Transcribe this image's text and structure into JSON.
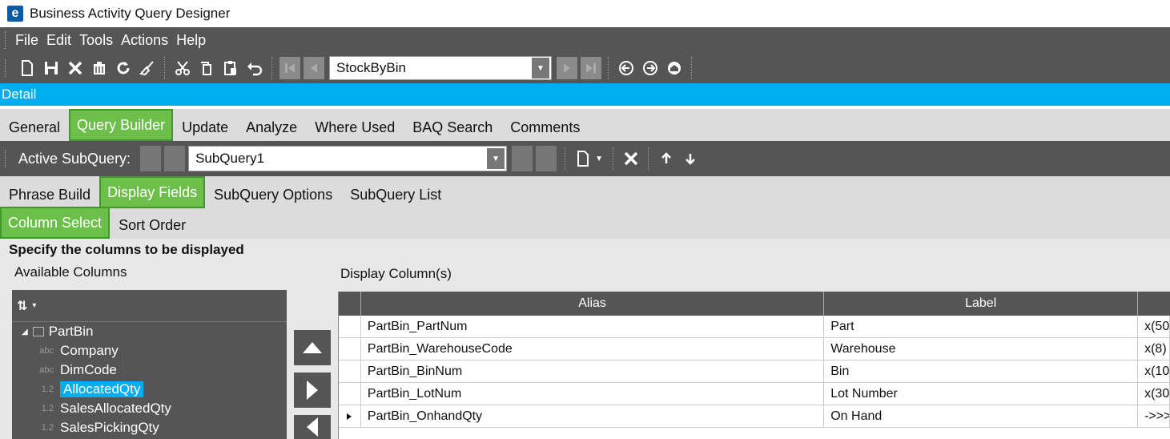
{
  "window": {
    "title": "Business Activity Query Designer",
    "logo_letter": "e"
  },
  "menu": [
    "File",
    "Edit",
    "Tools",
    "Actions",
    "Help"
  ],
  "toolbar": {
    "query_combo": "StockByBin"
  },
  "detail_bar": {
    "label": "Detail"
  },
  "main_tabs": [
    "General",
    "Query Builder",
    "Update",
    "Analyze",
    "Where Used",
    "BAQ Search",
    "Comments"
  ],
  "main_tabs_active": "Query Builder",
  "subquery": {
    "label": "Active SubQuery:",
    "value": "SubQuery1"
  },
  "sub_tabs": [
    "Phrase Build",
    "Display Fields",
    "SubQuery Options",
    "SubQuery List"
  ],
  "field_tabs": [
    "Column Select",
    "Sort Order"
  ],
  "content": {
    "instruction": "Specify the columns to be displayed",
    "available_label": "Available Columns",
    "display_label": "Display Column(s)"
  },
  "tree": {
    "table": "PartBin",
    "items": [
      {
        "type": "abc",
        "name": "Company"
      },
      {
        "type": "abc",
        "name": "DimCode"
      },
      {
        "type": "1.2",
        "name": "AllocatedQty",
        "selected": true
      },
      {
        "type": "1.2",
        "name": "SalesAllocatedQty"
      },
      {
        "type": "1.2",
        "name": "SalesPickingQty"
      }
    ]
  },
  "grid": {
    "headers": {
      "alias": "Alias",
      "label": "Label"
    },
    "rows": [
      {
        "alias": "PartBin_PartNum",
        "label": "Part",
        "format": "x(50"
      },
      {
        "alias": "PartBin_WarehouseCode",
        "label": "Warehouse",
        "format": "x(8)"
      },
      {
        "alias": "PartBin_BinNum",
        "label": "Bin",
        "format": "x(10"
      },
      {
        "alias": "PartBin_LotNum",
        "label": "Lot Number",
        "format": "x(30"
      },
      {
        "alias": "PartBin_OnhandQty",
        "label": "On Hand",
        "format": "->>>",
        "current": true
      }
    ]
  },
  "colors": {
    "toolbar_bg": "#555555",
    "accent_blue": "#00aeef",
    "tab_active_green": "#6cc04a"
  }
}
